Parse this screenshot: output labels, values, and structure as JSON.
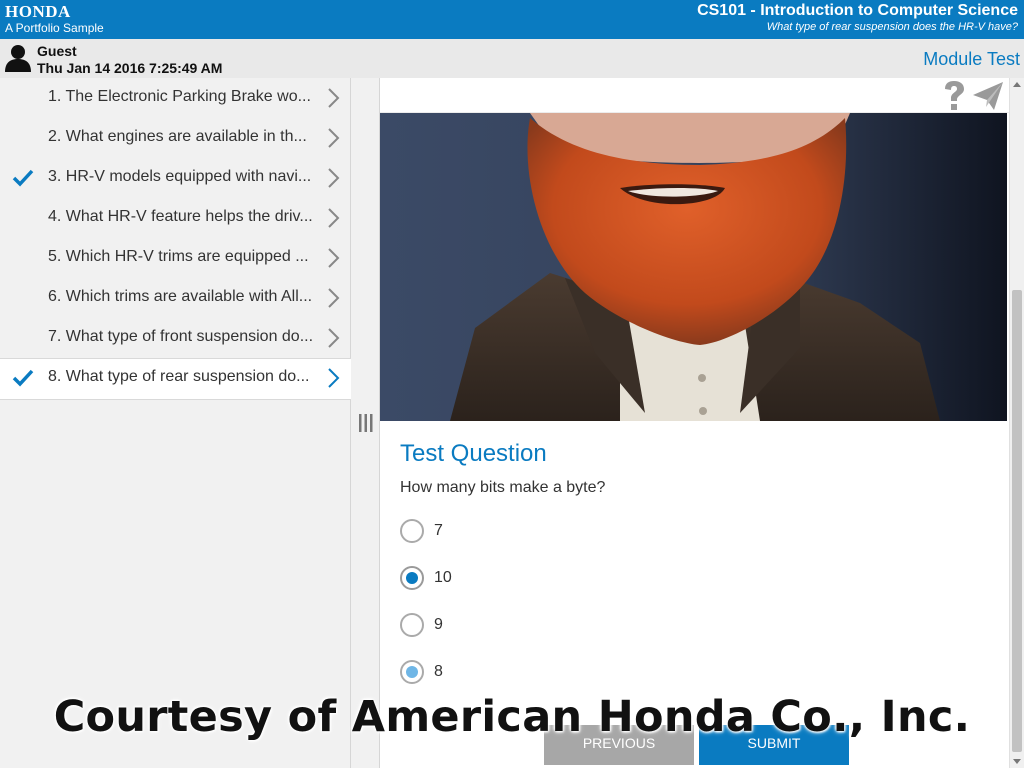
{
  "header": {
    "brand": "HONDA",
    "brand_sub": "A Portfolio Sample",
    "course_title": "CS101 - Introduction to Computer Science",
    "course_sub": "What type of rear suspension does the HR-V have?"
  },
  "user": {
    "name": "Guest",
    "datetime": "Thu Jan 14 2016 7:25:49 AM",
    "module": "Module Test"
  },
  "sidebar": {
    "items": [
      {
        "label": "1. The Electronic Parking Brake wo...",
        "checked": false,
        "active": false
      },
      {
        "label": "2. What engines are available in th...",
        "checked": false,
        "active": false
      },
      {
        "label": "3. HR-V models equipped with navi...",
        "checked": true,
        "active": false
      },
      {
        "label": "4. What HR-V feature helps the driv...",
        "checked": false,
        "active": false
      },
      {
        "label": "5. Which HR-V trims are equipped ...",
        "checked": false,
        "active": false
      },
      {
        "label": "6. Which trims are available with All...",
        "checked": false,
        "active": false
      },
      {
        "label": "7. What type of front suspension do...",
        "checked": false,
        "active": false
      },
      {
        "label": "8. What type of rear suspension do...",
        "checked": true,
        "active": true
      }
    ]
  },
  "question": {
    "title": "Test Question",
    "prompt": "How many bits make a byte?",
    "options": [
      {
        "label": "7",
        "state": "unselected"
      },
      {
        "label": "10",
        "state": "selected"
      },
      {
        "label": "9",
        "state": "unselected"
      },
      {
        "label": "8",
        "state": "hover"
      }
    ]
  },
  "buttons": {
    "previous": "PREVIOUS",
    "submit": "SUBMIT"
  },
  "watermark": "Courtesy of American Honda Co., Inc.",
  "colors": {
    "accent": "#0a7bc1",
    "sidebar_bg": "#f1f1f1",
    "button_disabled": "#a7a7a7"
  }
}
